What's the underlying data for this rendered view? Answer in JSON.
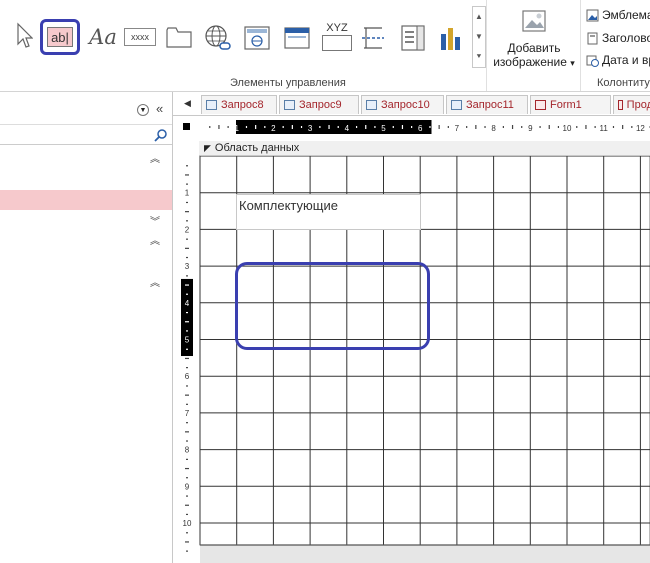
{
  "ribbon": {
    "group_controls_label": "Элементы управления",
    "group_header_label": "Колонтиту",
    "add_image_line1": "Добавить",
    "add_image_line2": "изображение",
    "add_image_arrow": "▾",
    "label_control_text": "Aa",
    "textbox_text": "ab|",
    "button_control_text": "xxxx",
    "xyz_text": "XYZ",
    "logo_label": "Эмблема",
    "title_label": "Заголово",
    "datetime_label": "Дата и вр"
  },
  "tabs": [
    {
      "label": "Запрос8",
      "type": "query"
    },
    {
      "label": "Запрос9",
      "type": "query"
    },
    {
      "label": "Запрос10",
      "type": "query"
    },
    {
      "label": "Запрос11",
      "type": "query"
    },
    {
      "label": "Form1",
      "type": "form"
    },
    {
      "label": "Прод",
      "type": "form"
    }
  ],
  "designer": {
    "section_label": "Область данных",
    "field_label": "Комплектующие",
    "ruler_top": [
      "1",
      "2",
      "3",
      "4",
      "5",
      "6",
      "7",
      "8",
      "9",
      "10",
      "11",
      "12"
    ],
    "ruler_left": [
      "1",
      "2",
      "3",
      "4",
      "5",
      "6",
      "7",
      "8",
      "9",
      "10"
    ]
  },
  "colors": {
    "highlight_outline": "#3a3fb0",
    "nav_selected": "#f6c9cc",
    "tab_text": "#a4262c"
  }
}
